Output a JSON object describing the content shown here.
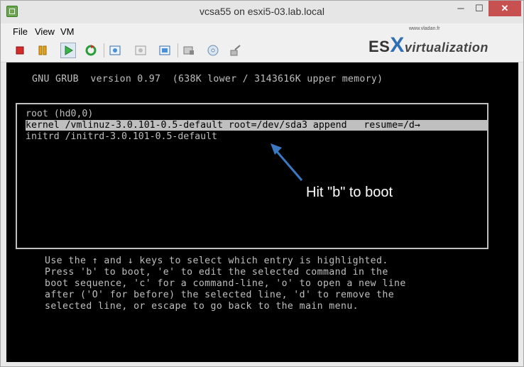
{
  "window": {
    "title": "vcsa55 on esxi5-03.lab.local",
    "min_glyph": "─",
    "max_glyph": "☐",
    "close_glyph": "✕"
  },
  "menu": [
    "File",
    "View",
    "VM"
  ],
  "toolbar": {
    "icons": [
      "stop-icon",
      "pause-icon",
      "play-icon",
      "reset-icon",
      "snapshot-icon",
      "revert-snapshot-icon",
      "manage-snapshots-icon",
      "console-settings-icon",
      "cd-dvd-icon",
      "network-icon"
    ]
  },
  "logo": {
    "url": "www.vladan.fr",
    "prefix": "ES",
    "x": "X",
    "suffix": "virtualization"
  },
  "grub": {
    "header": "GNU GRUB  version 0.97  (638K lower / 3143616K upper memory)",
    "entries": [
      "root (hd0,0)",
      "kernel /vmlinuz-3.0.101-0.5-default root=/dev/sda3 append   resume=/d→",
      "initrd /initrd-3.0.101-0.5-default"
    ],
    "selected_index": 1,
    "annotation": "Hit \"b\" to boot",
    "help": [
      "Use the ↑ and ↓ keys to select which entry is highlighted.",
      "Press 'b' to boot, 'e' to edit the selected command in the",
      "boot sequence, 'c' for a command-line, 'o' to open a new line",
      "after ('O' for before) the selected line, 'd' to remove the",
      "selected line, or escape to go back to the main menu."
    ]
  },
  "colors": {
    "console_bg": "#000000",
    "console_fg": "#bfbfbf",
    "annotation_arrow": "#3a78c2",
    "close_button": "#c75050"
  }
}
